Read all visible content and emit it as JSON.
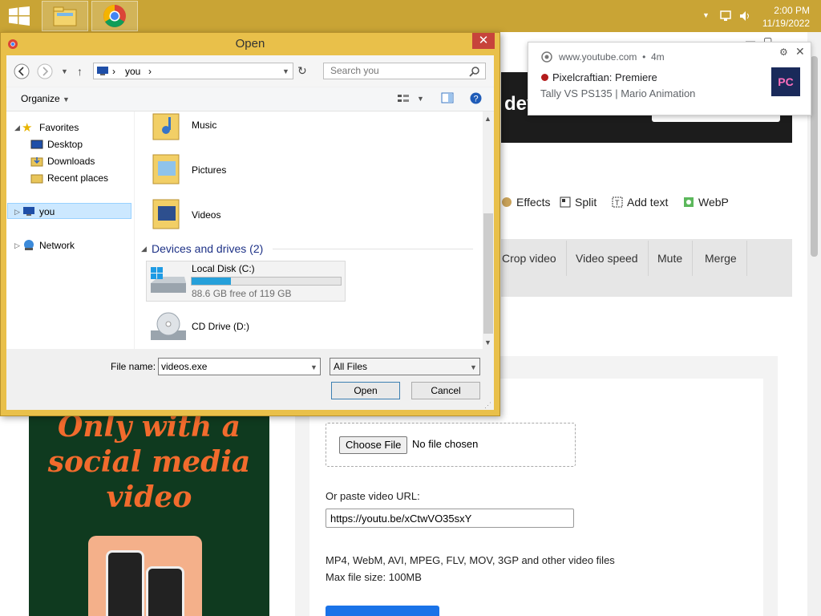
{
  "taskbar": {
    "start_icon": "windows-logo-icon",
    "pinned": [
      "file-explorer-icon",
      "chrome-icon"
    ],
    "tray_icons": [
      "chevron-up-icon",
      "network-icon",
      "volume-icon"
    ],
    "time": "2:00 PM",
    "date": "11/19/2022",
    "color": "#c9a435"
  },
  "webpage": {
    "banner_title": "developers",
    "trial_button": "Start your free trial →",
    "tools": [
      "Effects",
      "Split",
      "Add text",
      "WebP"
    ],
    "tabs": [
      "Crop video",
      "Video speed",
      "Mute",
      "Merge"
    ],
    "choose_file": "Choose File",
    "no_file": "No file chosen",
    "url_label": "Or paste video URL:",
    "url_value": "https://youtu.be/xCtwVO35sxY",
    "formats_text": "MP4, WebM, AVI, MPEG, FLV, MOV, 3GP and other video files",
    "max_size": "Max file size: 100MB",
    "ad_line1": "Only with a",
    "ad_line2": "social media",
    "ad_line3": "video"
  },
  "notification": {
    "site": "www.youtube.com",
    "time": "4m",
    "title": "Pixelcraftian: Premiere",
    "body": "Tally VS PS135 | Mario Animation",
    "thumb_text": "PC"
  },
  "dialog": {
    "title": "Open",
    "close": "✕",
    "address": {
      "path_item": "you",
      "sep": "›"
    },
    "search_placeholder": "Search you",
    "organize": "Organize",
    "nav": {
      "favorites": "Favorites",
      "desktop": "Desktop",
      "downloads": "Downloads",
      "recent": "Recent places",
      "you": "you",
      "network": "Network"
    },
    "folders": [
      "Music",
      "Pictures",
      "Videos"
    ],
    "devices_header": "Devices and drives (2)",
    "drives": [
      {
        "name": "Local Disk (C:)",
        "free": "88.6 GB free of 119 GB",
        "used_fraction": 0.26
      },
      {
        "name": "CD Drive (D:)"
      }
    ],
    "file_name_label": "File name:",
    "file_name": "videos.exe",
    "filter": "All Files",
    "open_button": "Open",
    "cancel_button": "Cancel"
  },
  "colors": {
    "accent": "#e9c04a",
    "close": "#c7433b",
    "link_blue": "#1e3287",
    "disk_fill": "#26a0da"
  }
}
